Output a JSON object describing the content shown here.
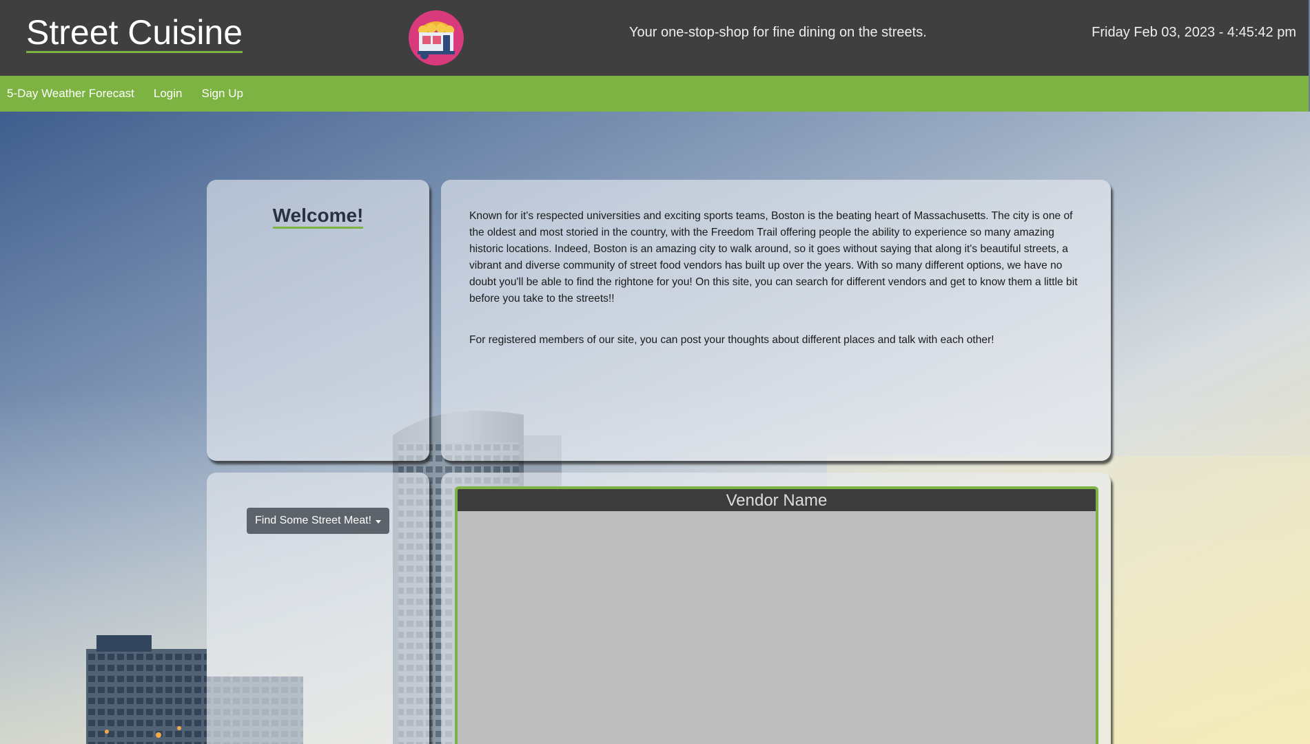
{
  "header": {
    "site_title": "Street Cuisine",
    "tagline": "Your one-stop-shop for fine dining on the streets.",
    "datetime": "Friday Feb 03, 2023 - 4:45:42 pm",
    "logo_icon": "food-cart-icon"
  },
  "nav": {
    "items": [
      {
        "label": "5-Day Weather Forecast"
      },
      {
        "label": "Login"
      },
      {
        "label": "Sign Up"
      }
    ]
  },
  "welcome": {
    "title": "Welcome!"
  },
  "about": {
    "paragraph1": "Known for it's respected universities and exciting sports teams, Boston is the beating heart of Massachusetts. The city is one of the oldest and most storied in the country, with the Freedom Trail offering people the ability to experience so many amazing historic locations. Indeed, Boston is an amazing city to walk around, so it goes without saying that along it's beautiful streets, a vibrant and diverse community of street food vendors has built up over the years. With so many different options, we have no doubt you'll be able to find the rightone for you! On this site, you can search for different vendors and get to know them a little bit before you take to the streets!!",
    "paragraph2": "For registered members of our site, you can post your thoughts about different places and talk with each other!"
  },
  "search": {
    "dropdown_label": "Find Some Street Meat!"
  },
  "vendor": {
    "header": "Vendor Name"
  },
  "colors": {
    "header_bg": "#3f3f3f",
    "nav_bg": "#7cb342",
    "accent": "#7cb342",
    "button_bg": "#5c636a"
  }
}
